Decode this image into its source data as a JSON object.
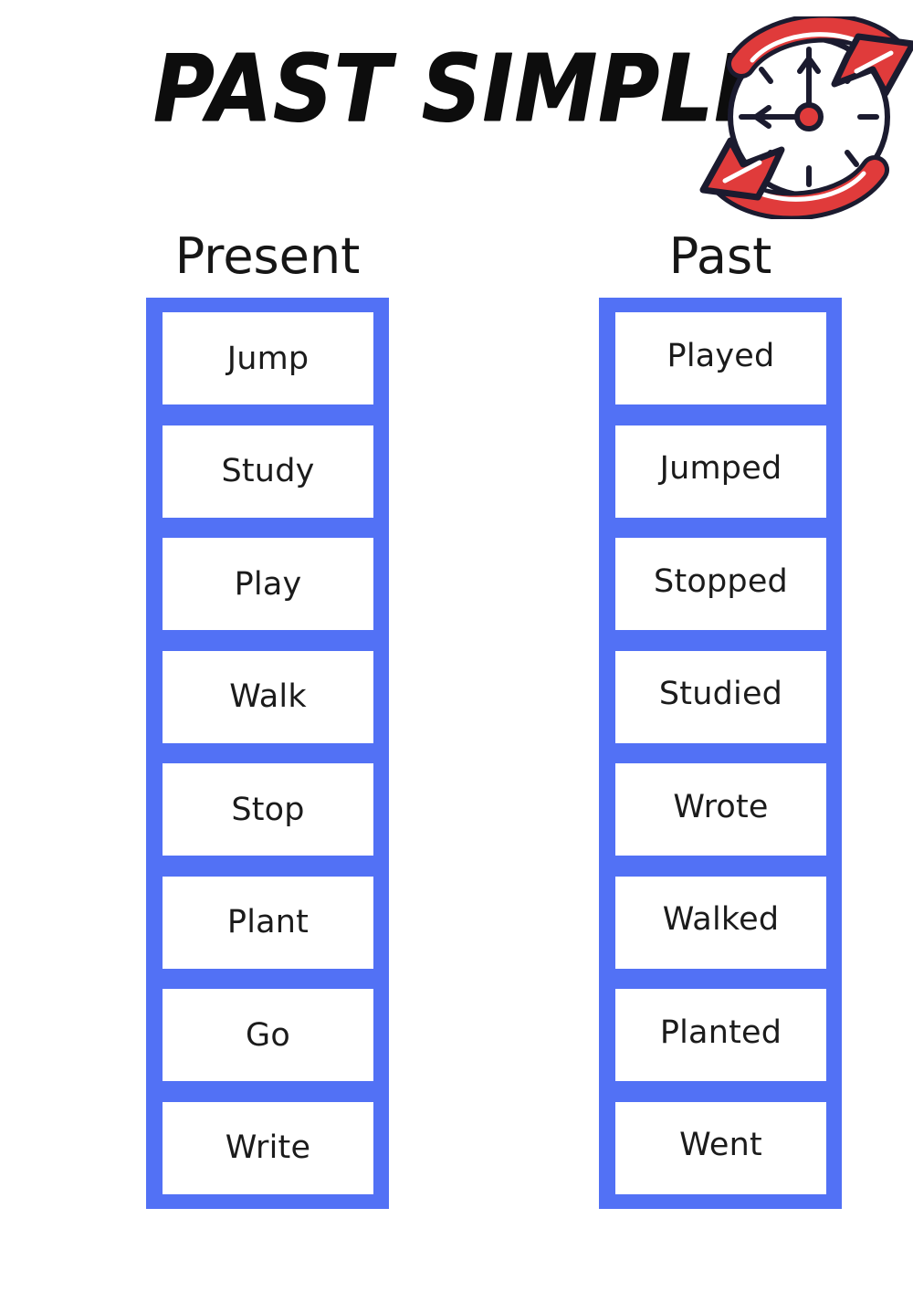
{
  "header": {
    "title": "PAST SIMPLE",
    "clock_icon": "clock-refresh-icon"
  },
  "colors": {
    "blue": "#5271F5",
    "red": "#E03B3B",
    "outline": "#1B1B2F",
    "text": "#1B1B1B",
    "background": "#FFFFFF"
  },
  "columns": [
    {
      "heading": "Present",
      "words": [
        "Jump",
        "Study",
        "Play",
        "Walk",
        "Stop",
        "Plant",
        "Go",
        "Write"
      ]
    },
    {
      "heading": "Past",
      "words": [
        "Played",
        "Jumped",
        "Stopped",
        "Studied",
        "Wrote",
        "Walked",
        "Planted",
        "Went"
      ]
    }
  ]
}
